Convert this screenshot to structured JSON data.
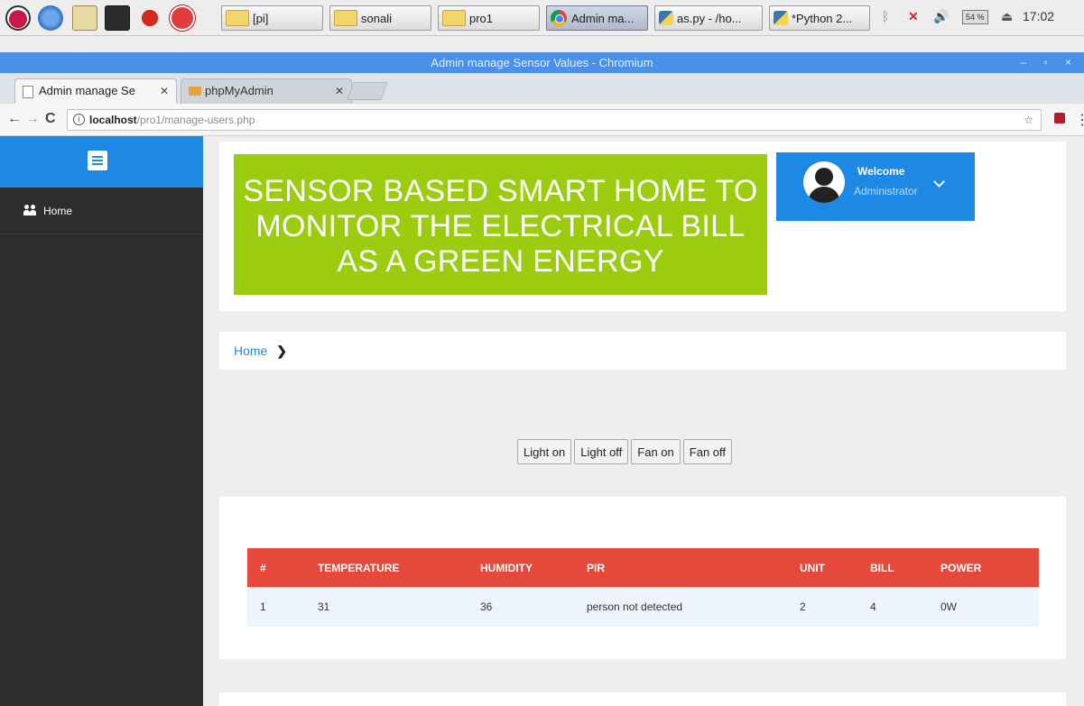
{
  "taskbar": {
    "tasks": [
      "[pi]",
      "sonali",
      "pro1",
      "Admin ma...",
      "as.py - /ho...",
      "*Python 2..."
    ],
    "battery": "54 %",
    "clock": "17:02"
  },
  "window": {
    "title": "Admin manage Sensor Values - Chromium"
  },
  "tabs": [
    {
      "label": "Admin manage Se"
    },
    {
      "label": "phpMyAdmin"
    }
  ],
  "address_bar": {
    "host": "localhost",
    "path": "/pro1/manage-users.php"
  },
  "sidebar": {
    "items": [
      {
        "label": "Home"
      }
    ]
  },
  "header": {
    "banner_lines": [
      "SENSOR BASED SMART HOME TO",
      "MONITOR THE ELECTRICAL BILL",
      "AS A GREEN ENERGY"
    ],
    "welcome_title": "Welcome",
    "welcome_user": "Administrator"
  },
  "breadcrumb": {
    "home": "Home",
    "separator": "❯"
  },
  "controls": [
    "Light on",
    "Light off",
    "Fan on",
    "Fan off"
  ],
  "table": {
    "columns": [
      "#",
      "TEMPERATURE",
      "HUMIDITY",
      "PIR",
      "UNIT",
      "BILL",
      "POWER"
    ],
    "rows": [
      [
        "1",
        "31",
        "36",
        "person not detected",
        "2",
        "4",
        "0W"
      ]
    ]
  },
  "colors": {
    "accent_blue": "#1e88e5",
    "banner_green": "#9ccc0f",
    "table_header_red": "#e6483c",
    "sidebar_dark": "#2d2d2d",
    "titlebar_blue": "#4a8fe8"
  }
}
